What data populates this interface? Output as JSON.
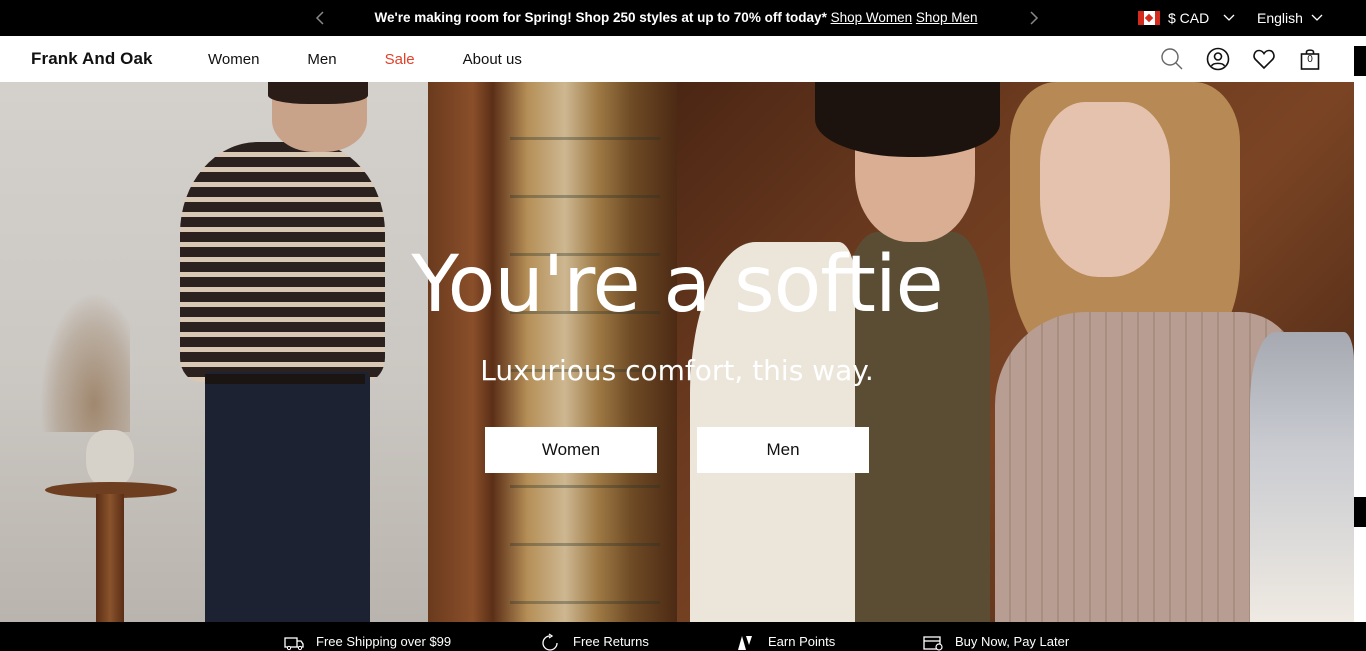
{
  "announcement": {
    "message": "We're making room for Spring! Shop 250 styles at up to 70% off today*",
    "link_women": "Shop Women",
    "link_men": "Shop Men",
    "prev_icon": "chevron-left-icon",
    "next_icon": "chevron-right-icon"
  },
  "locale": {
    "currency": "$ CAD",
    "language": "English",
    "flag": "canada-flag"
  },
  "header": {
    "logo": "Frank And Oak",
    "nav": [
      "Women",
      "Men",
      "Sale",
      "About us"
    ],
    "sale_color": "#e2412b",
    "bag_count": "0",
    "icons": [
      "search-icon",
      "account-icon",
      "heart-icon",
      "bag-icon"
    ]
  },
  "hero": {
    "title": "You're a softie",
    "subtitle": "Luxurious comfort, this way.",
    "buttons": [
      "Women",
      "Men"
    ]
  },
  "perks": [
    {
      "label": "Free Shipping over $99",
      "icon": "truck-icon"
    },
    {
      "label": "Free Returns",
      "icon": "returns-icon"
    },
    {
      "label": "Earn Points",
      "icon": "points-icon"
    },
    {
      "label": "Buy Now, Pay Later",
      "icon": "card-icon"
    }
  ]
}
